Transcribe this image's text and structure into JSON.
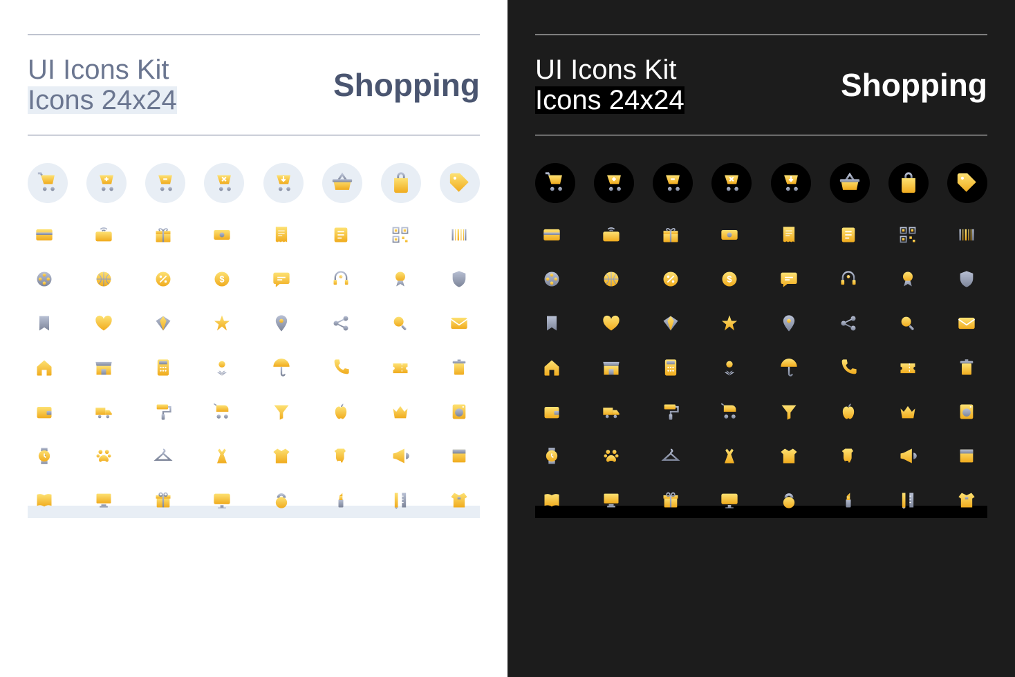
{
  "header": {
    "kit_title": "UI Icons Kit",
    "kit_subtitle": "Icons 24x24",
    "category": "Shopping"
  },
  "colors": {
    "yellow_light": "#fbd34d",
    "yellow_dark": "#f2b420",
    "gray": "#9aa3b8",
    "gray_dark": "#7a8399"
  },
  "hero_icons": [
    "cart",
    "cart-add",
    "cart-remove",
    "cart-cancel",
    "cart-down",
    "basket",
    "bag",
    "tag"
  ],
  "icon_grid": [
    [
      "credit-card",
      "card-wifi",
      "gift",
      "cash",
      "receipt",
      "list",
      "qr-code",
      "barcode"
    ],
    [
      "film",
      "basketball",
      "percent",
      "dollar-coin",
      "chat",
      "headset",
      "award",
      "shield"
    ],
    [
      "bookmark",
      "heart",
      "diamond",
      "star",
      "map-pin",
      "share",
      "search",
      "mail"
    ],
    [
      "home",
      "store",
      "calculator",
      "flower",
      "umbrella",
      "phone",
      "ticket",
      "trash"
    ],
    [
      "wallet",
      "truck",
      "paint-roller",
      "stroller",
      "funnel",
      "apple",
      "crown",
      "washer"
    ],
    [
      "watch",
      "paw",
      "hanger",
      "dress",
      "tshirt",
      "onesie",
      "megaphone",
      "box"
    ],
    [
      "book",
      "screen",
      "gift-box",
      "monitor",
      "kettlebell",
      "lipstick",
      "pencil-ruler",
      "shirt"
    ]
  ]
}
